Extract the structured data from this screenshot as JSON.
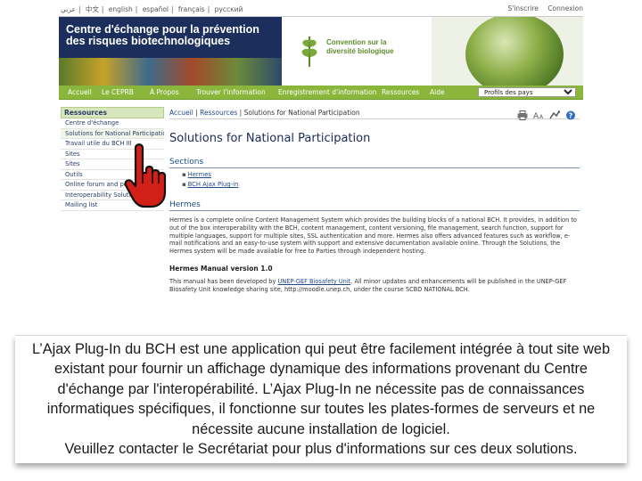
{
  "langbar": {
    "languages": [
      "عربي",
      "中文",
      "english",
      "español",
      "français",
      "русский"
    ],
    "register": "S'inscrire",
    "login": "Connexion"
  },
  "banner": {
    "title_line1": "Centre d'échange pour la prévention",
    "title_line2": "des risques biotechnologiques",
    "cbd_line1": "Convention sur la",
    "cbd_line2": "diversité biologique"
  },
  "nav": {
    "items": [
      "Accueil",
      "Le CEPRB",
      "À Propos",
      "Trouver l'information",
      "Enregistrement d'information",
      "Ressources",
      "Aide"
    ],
    "select_value": "Profils des pays"
  },
  "sidebar": {
    "header": "Ressources",
    "items": [
      "Centre d'échange",
      "Solutions for National Participation",
      "Travail utile du BCH III",
      "Sites",
      "Sites",
      "Outils",
      "Online forum and portals",
      "Interoperability Solutions",
      "Mailing list"
    ]
  },
  "main": {
    "breadcrumb_home": "Accueil",
    "breadcrumb_sep1": " | ",
    "breadcrumb_resources": "Ressources",
    "breadcrumb_sep2": " | ",
    "breadcrumb_current": "Solutions for National Participation",
    "page_title": "Solutions for National Participation",
    "sections_header": "Sections",
    "section_links": [
      "Hermes",
      "BCH Ajax Plug-in"
    ],
    "hermes_header": "Hermes",
    "hermes_text": "Hermes is a complete online Content Management System which provides the building blocks of a national BCH. It provides, in addition to out of the box interoperability with the BCH, content management, content versioning, file management, search function, support for multiple languages, support for multiple sites, SSL authentication and more. Hermes also offers advanced features such as workflow, e-mail notifications and an easy-to-use system with support and extensive documentation available online. Through the Solutions, the Hermes system will be made available for free to Parties through independent hosting.",
    "manual_header": "Hermes Manual version 1.0",
    "manual_text_a": "This manual has been developed by ",
    "manual_link": "UNEP-GEF Biosafety Unit",
    "manual_text_b": ". All minor updates and enhancements will be published in the UNEP-GEF Biosafety Unit knowledge sharing site, http://moodle.unep.ch, under the course SCBD NATIONAL BCH."
  },
  "caption": {
    "p1": "L’Ajax Plug-In du BCH est une application qui peut être facilement intégrée à tout site web existant pour fournir un affichage dynamique des informations provenant du Centre d'échange par l'interopérabilité. L’Ajax Plug-In ne nécessite pas de connaissances informatiques spécifiques, il fonctionne sur toutes les plates-formes de serveurs et ne nécessite aucune installation de logiciel.",
    "p2": "Veuillez contacter le Secrétariat  pour plus d'informations sur ces deux solutions."
  }
}
